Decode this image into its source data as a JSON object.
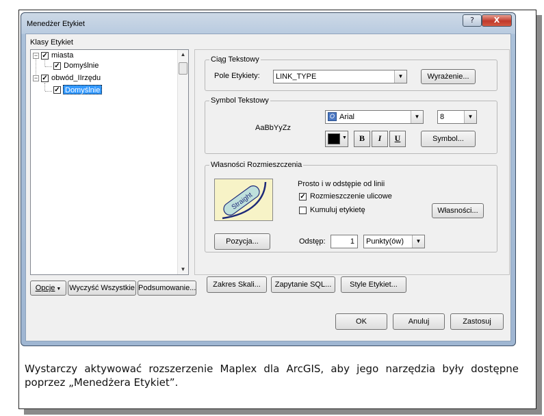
{
  "window": {
    "title": "Menedżer Etykiet",
    "help_label": "?",
    "close_label": "X"
  },
  "classes": {
    "label": "Klasy Etykiet",
    "tree": [
      {
        "label": "miasta",
        "checked": true,
        "expanded": true
      },
      {
        "label": "Domyślnie",
        "checked": true
      },
      {
        "label": "obwód_IIrzędu",
        "checked": true,
        "expanded": true
      },
      {
        "label": "Domyślnie",
        "checked": true,
        "selected": true
      }
    ]
  },
  "bottom_left_buttons": {
    "options": "Opcje",
    "clear_all": "Wyczyść Wszystkie",
    "summary": "Podsumowanie..."
  },
  "text_string": {
    "legend": "Ciąg Tekstowy",
    "field_label": "Pole Etykiety:",
    "field_value": "LINK_TYPE",
    "expression_button": "Wyrażenie..."
  },
  "text_symbol": {
    "legend": "Symbol Tekstowy",
    "sample": "AaBbYyZz",
    "font": "Arial",
    "size": "8",
    "bold": "B",
    "italic": "I",
    "underline": "U",
    "symbol_button": "Symbol...",
    "color": "#000000"
  },
  "placement": {
    "legend": "Własności Rozmieszczenia",
    "mode": "Prosto i w odstępie od linii",
    "street_placement": "Rozmieszczenie ulicowe",
    "street_checked": true,
    "stack": "Kumuluj etykietę",
    "stack_checked": false,
    "properties_button": "Własności...",
    "preview_text": "Straight",
    "position_button": "Pozycja...",
    "offset_label": "Odstęp:",
    "offset_value": "1",
    "units": "Punkty(ów)"
  },
  "scale_buttons": {
    "scale_range": "Zakres Skali...",
    "sql_query": "Zapytanie SQL...",
    "label_styles": "Style Etykiet..."
  },
  "dialog_buttons": {
    "ok": "OK",
    "cancel": "Anuluj",
    "apply": "Zastosuj"
  },
  "caption": "Wystarczy aktywować rozszerzenie Maplex dla ArcGIS, aby jego narzędzia były dostępne poprzez „Menedżera Etykiet”."
}
